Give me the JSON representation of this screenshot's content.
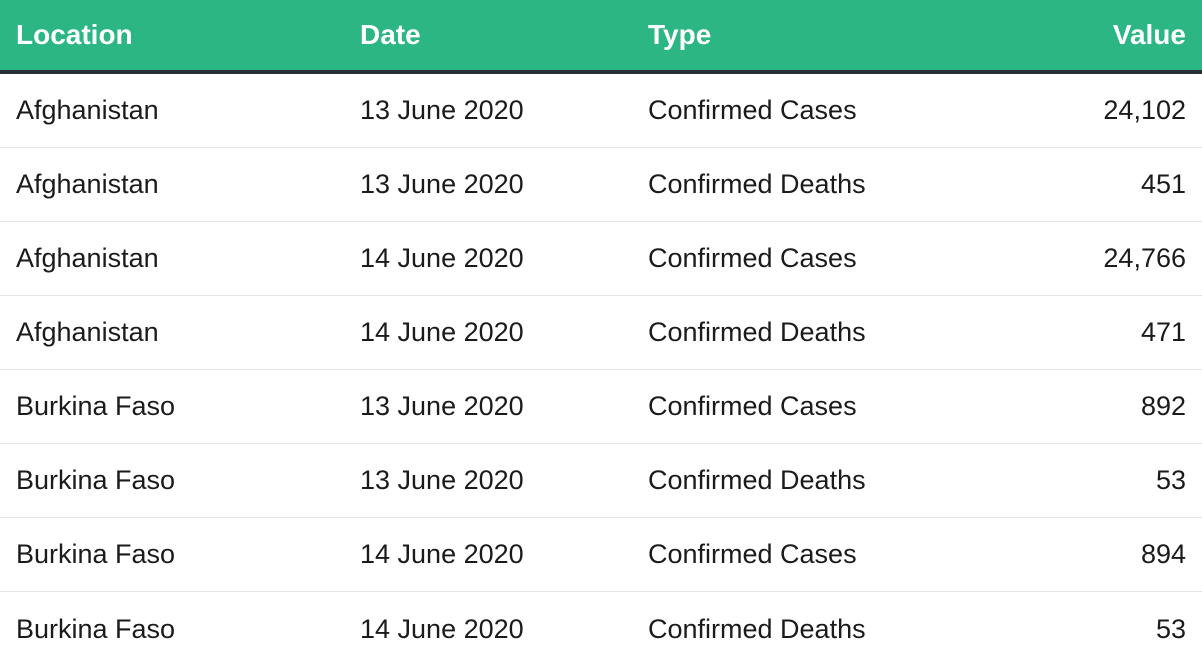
{
  "table": {
    "columns": {
      "location": "Location",
      "date": "Date",
      "type": "Type",
      "value": "Value"
    },
    "rows": [
      {
        "location": "Afghanistan",
        "date": "13 June 2020",
        "type": "Confirmed Cases",
        "value": "24,102"
      },
      {
        "location": "Afghanistan",
        "date": "13 June 2020",
        "type": "Confirmed Deaths",
        "value": "451"
      },
      {
        "location": "Afghanistan",
        "date": "14 June 2020",
        "type": "Confirmed Cases",
        "value": "24,766"
      },
      {
        "location": "Afghanistan",
        "date": "14 June 2020",
        "type": "Confirmed Deaths",
        "value": "471"
      },
      {
        "location": "Burkina Faso",
        "date": "13 June 2020",
        "type": "Confirmed Cases",
        "value": "892"
      },
      {
        "location": "Burkina Faso",
        "date": "13 June 2020",
        "type": "Confirmed Deaths",
        "value": "53"
      },
      {
        "location": "Burkina Faso",
        "date": "14 June 2020",
        "type": "Confirmed Cases",
        "value": "894"
      },
      {
        "location": "Burkina Faso",
        "date": "14 June 2020",
        "type": "Confirmed Deaths",
        "value": "53"
      }
    ]
  },
  "colors": {
    "header_bg": "#2bb683",
    "header_border": "#273238",
    "row_border": "#e6e6e6"
  }
}
